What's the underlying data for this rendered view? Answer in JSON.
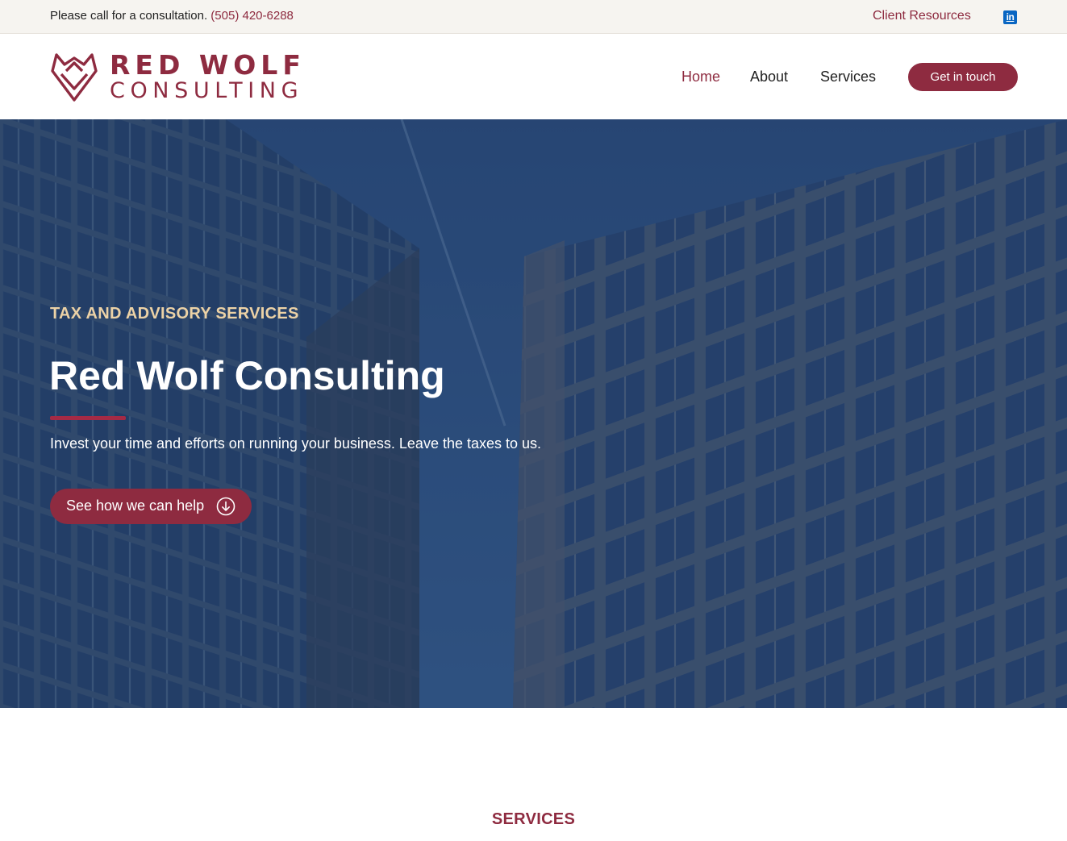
{
  "topbar": {
    "consult_text": "Please call for a consultation.",
    "phone": "(505) 420-6288",
    "client_resources": "Client Resources",
    "linkedin_glyph": "in"
  },
  "brand": {
    "line1": "RED WOLF",
    "line2": "CONSULTING"
  },
  "nav": {
    "items": [
      "Home",
      "About",
      "Services"
    ],
    "active": "Home",
    "cta": "Get in touch"
  },
  "hero": {
    "eyebrow": "TAX AND ADVISORY SERVICES",
    "title": "Red Wolf Consulting",
    "subtitle": "Invest your time and efforts on running your business. Leave the taxes to us.",
    "button": "See how we can help"
  },
  "sections": {
    "services_label": "SERVICES"
  },
  "icons": {
    "logo": "wolf-head-icon",
    "linkedin": "linkedin-icon",
    "arrow": "arrow-down-circle-icon"
  },
  "colors": {
    "brand": "#8e2b40",
    "eyebrow": "#ecd2a6",
    "topbar_bg": "#f6f4f0",
    "hero_overlay": "#1e3a63"
  }
}
